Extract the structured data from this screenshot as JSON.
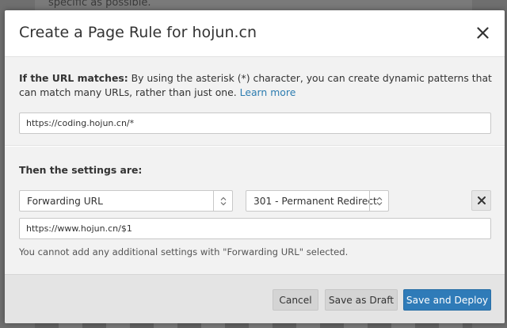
{
  "background": {
    "text": "specific as possible."
  },
  "modal": {
    "title": "Create a Page Rule for hojun.cn",
    "close_icon": "close-icon"
  },
  "url_section": {
    "label_bold": "If the URL matches:",
    "description": " By using the asterisk (*) character, you can create dynamic patterns that can match many URLs, rather than just one. ",
    "learn_more": "Learn more",
    "url_value": "https://coding.hojun.cn/*"
  },
  "settings_section": {
    "title": "Then the settings are:",
    "setting_select": "Forwarding URL",
    "status_select": "301 - Permanent Redirect",
    "forward_url_value": "https://www.hojun.cn/$1",
    "note": "You cannot add any additional settings with \"Forwarding URL\" selected.",
    "remove_icon": "close-icon"
  },
  "footer": {
    "cancel_label": "Cancel",
    "draft_label": "Save as Draft",
    "deploy_label": "Save and Deploy"
  },
  "colors": {
    "primary": "#2f7bb8",
    "link": "#2c7cb0",
    "section_bg": "#f2f2f2",
    "footer_bg": "#e4e4e4"
  }
}
